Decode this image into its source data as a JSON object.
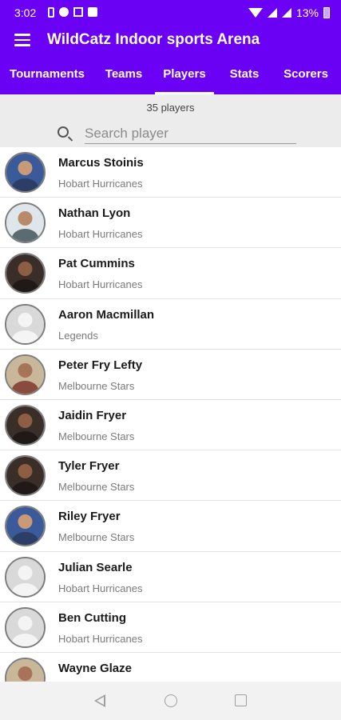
{
  "status_bar": {
    "time": "3:02",
    "battery": "13%",
    "icons": [
      "battery-saver-icon",
      "facebook-icon",
      "gmail-icon",
      "gallery-icon",
      "wifi-icon",
      "signal-icon",
      "battery-icon"
    ]
  },
  "app_bar": {
    "title": "WildCatz Indoor sports Arena",
    "color": "#6a00f4"
  },
  "tabs": [
    {
      "label": "Tournaments",
      "active": false
    },
    {
      "label": "Teams",
      "active": false
    },
    {
      "label": "Players",
      "active": true
    },
    {
      "label": "Stats",
      "active": false
    },
    {
      "label": "Scorers",
      "active": false
    }
  ],
  "summary": {
    "count_text": "35 players"
  },
  "search": {
    "placeholder": "Search player",
    "value": ""
  },
  "players": [
    {
      "name": "Marcus Stoinis",
      "team": "Hobart Hurricanes",
      "avatar": "photo-blue"
    },
    {
      "name": "Nathan Lyon",
      "team": "Hobart Hurricanes",
      "avatar": "photo-light"
    },
    {
      "name": "Pat Cummins",
      "team": "Hobart Hurricanes",
      "avatar": "photo-dark"
    },
    {
      "name": "Aaron Macmillan",
      "team": "Legends",
      "avatar": "placeholder"
    },
    {
      "name": "Peter Fry Lefty",
      "team": "Melbourne Stars",
      "avatar": "photo-warm"
    },
    {
      "name": "Jaidin Fryer",
      "team": "Melbourne Stars",
      "avatar": "photo-dark"
    },
    {
      "name": "Tyler Fryer",
      "team": "Melbourne Stars",
      "avatar": "photo-dark"
    },
    {
      "name": "Riley Fryer",
      "team": "Melbourne Stars",
      "avatar": "photo-blue"
    },
    {
      "name": "Julian Searle",
      "team": "Hobart Hurricanes",
      "avatar": "placeholder"
    },
    {
      "name": "Ben Cutting",
      "team": "Hobart Hurricanes",
      "avatar": "placeholder"
    },
    {
      "name": "Wayne Glaze",
      "team": "",
      "avatar": "photo-warm"
    }
  ],
  "nav_bar": {
    "buttons": [
      "back-icon",
      "home-icon",
      "recents-icon"
    ]
  }
}
